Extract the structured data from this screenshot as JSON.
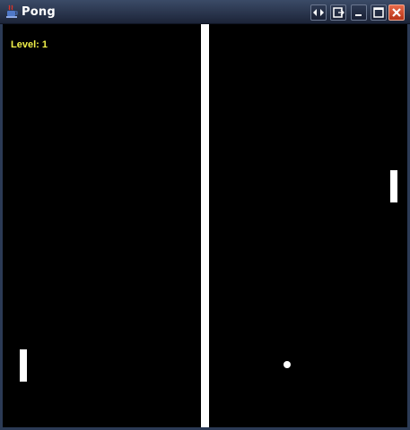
{
  "window": {
    "title": "Pong"
  },
  "titlebar": {
    "icons": [
      "java-cup-icon",
      "resize-arrows-icon",
      "restore-window-icon",
      "minimize-icon",
      "maximize-icon",
      "close-icon"
    ]
  },
  "game": {
    "level_text": "Level: 1",
    "colors": {
      "background": "#000000",
      "net": "#ffffff",
      "paddles": "#ffffff",
      "ball": "#ffffff",
      "level_text": "#f2f24a"
    }
  }
}
